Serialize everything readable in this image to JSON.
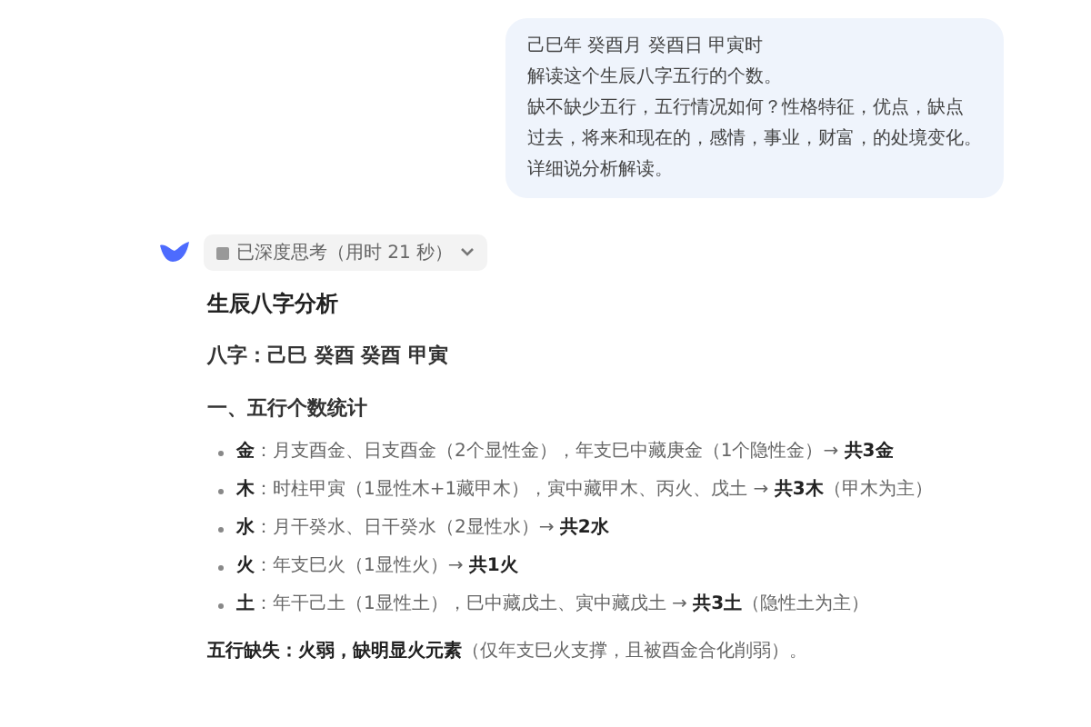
{
  "user_message": {
    "lines": [
      "己巳年 癸酉月 癸酉日 甲寅时",
      "解读这个生辰八字五行的个数。",
      "缺不缺少五行，五行情况如何？性格特征，优点，缺点",
      "过去，将来和现在的，感情，事业，财富，的处境变化。",
      "详细说分析解读。"
    ]
  },
  "assistant": {
    "thinking": {
      "label": "已深度思考（用时 21 秒）",
      "expanded": false
    },
    "title": "生辰八字分析",
    "bazi": "八字：己巳 癸酉 癸酉 甲寅",
    "section": "一、五行个数统计",
    "bullets": [
      {
        "text": "**金**：月支酉金、日支酉金（2个显性金），年支巳中藏庚金（1个隐性金）→ **共3金**"
      },
      {
        "text": "**木**：时柱甲寅（1显性木+1藏甲木），寅中藏甲木、丙火、戊土 → **共3木**（甲木为主）"
      },
      {
        "text": "**水**：月干癸水、日干癸水（2显性水）→ **共2水**"
      },
      {
        "text": "**火**：年支巳火（1显性火）→ **共1火**"
      },
      {
        "text": "**土**：年干己土（1显性土），巳中藏戊土、寅中藏戊土 → **共3土**（隐性土为主）"
      }
    ],
    "summary": "**五行缺失：火弱，缺明显火元素**（仅年支巳火支撑，且被酉金合化削弱）。"
  }
}
